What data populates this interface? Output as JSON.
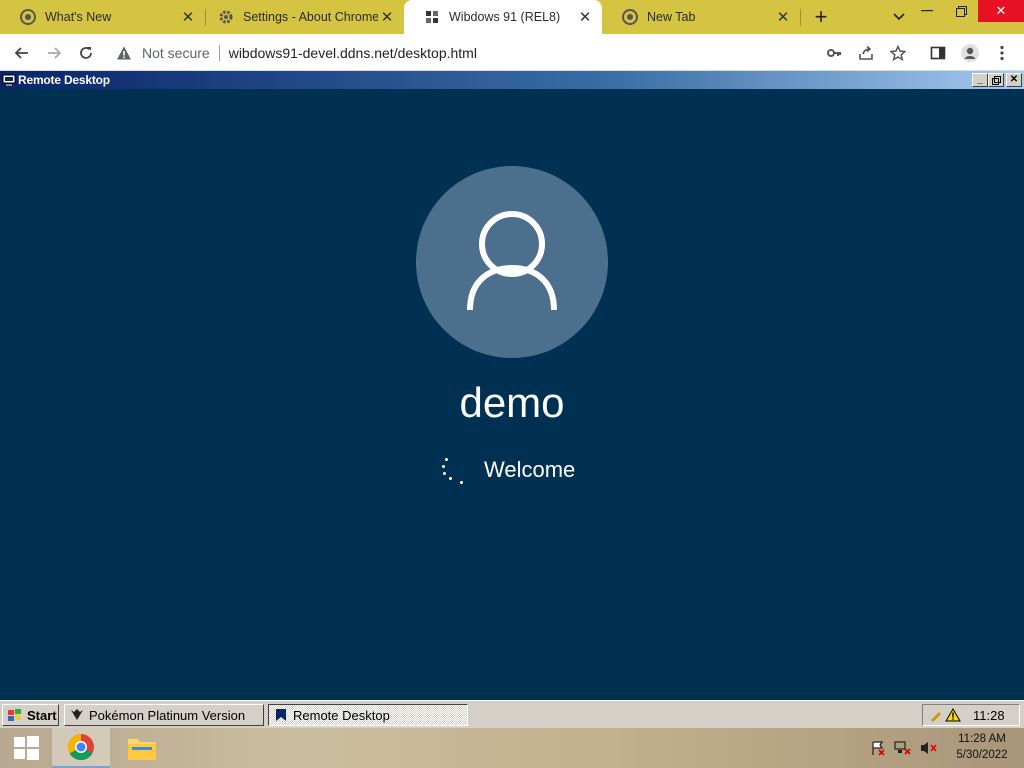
{
  "browser": {
    "tabs": [
      {
        "title": "What's New",
        "icon": "chrome-logo-icon",
        "active": false
      },
      {
        "title": "Settings - About Chrome",
        "icon": "gear-icon",
        "active": false
      },
      {
        "title": "Wibdows 91 (REL8)",
        "icon": "wibdows-logo-icon",
        "active": true
      },
      {
        "title": "New Tab",
        "icon": "chrome-logo-icon",
        "active": false
      }
    ],
    "new_tab_symbol": "+",
    "address": {
      "security_label": "Not secure",
      "url": "wibdows91-devel.ddns.net/desktop.html"
    }
  },
  "remote_desktop": {
    "title": "Remote Desktop",
    "username": "demo",
    "status": "Welcome",
    "background_color": "#003152",
    "avatar_color": "#4c6f8e"
  },
  "taskbar": {
    "start_label": "Start",
    "items": [
      {
        "label": "Pokémon Platinum Version",
        "pressed": false
      },
      {
        "label": "Remote Desktop",
        "pressed": true
      }
    ],
    "clock": "11:28"
  },
  "host_taskbar": {
    "time": "11:28 AM",
    "date": "5/30/2022"
  }
}
